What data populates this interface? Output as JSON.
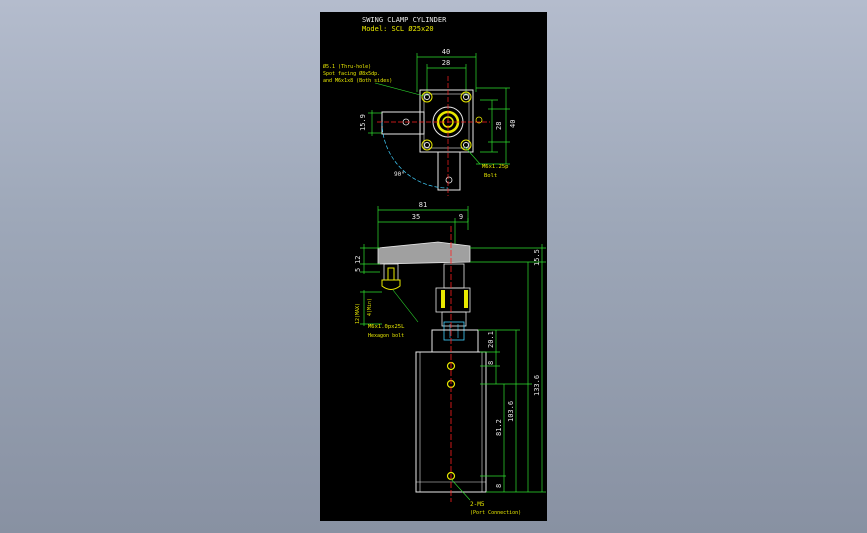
{
  "title": "SWING CLAMP CYLINDER",
  "model": "Model: SCL Ø25x20",
  "notes": {
    "hole": "Ø5.1 (Thru-hole)",
    "spot": "Spot facing Ø8x5dp.",
    "thread": "and M6x1x8 (Both sides)",
    "bolt_top": "M6x1.25p",
    "bolt_top_sub": "Bolt",
    "angle": "90°",
    "hex_bolt": "M6x1.0px25L",
    "hex_bolt_sub": "Hexagon bolt",
    "port": "2-M5",
    "port_sub": "(Port Connection)",
    "max": "12(MAX)",
    "min": "4(Min)"
  },
  "dims": {
    "d40_top": "40",
    "d28_top": "28",
    "d28_side": "28",
    "d40_side": "40",
    "d15_9": "15.9",
    "d81": "81",
    "d35": "35",
    "d9": "9",
    "d15_5": "15.5",
    "d12": "12",
    "d5": "5",
    "d20_1": "20.1",
    "d8_a": "8",
    "d103_6": "103.6",
    "d133_6": "133.6",
    "d81_2": "81.2",
    "d8_b": "8"
  },
  "colors": {
    "background": "#000000",
    "outline": "#e8e8e8",
    "yellow": "#e8e800",
    "green": "#2ee02e",
    "red": "#ff2020",
    "cyan": "#40d0ff"
  }
}
